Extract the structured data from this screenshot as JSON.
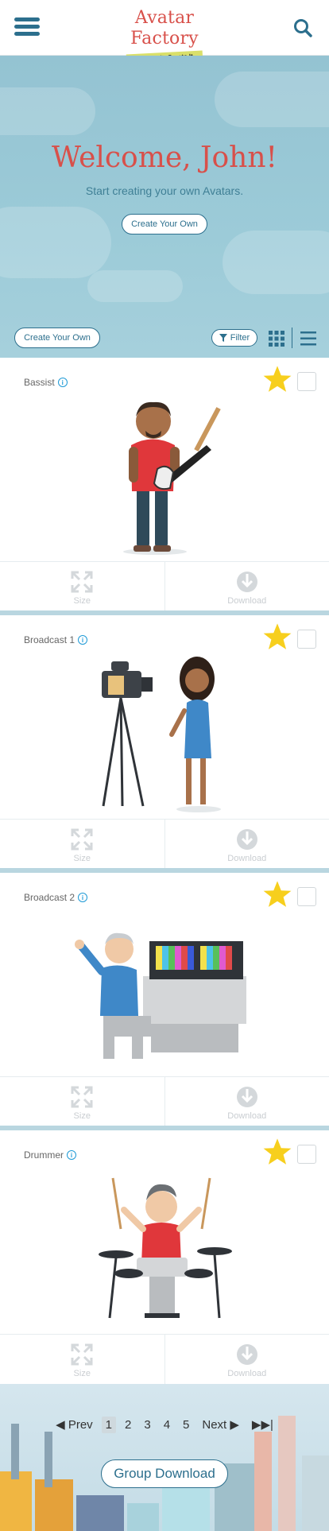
{
  "header": {
    "menu_icon": "hamburger-icon",
    "logo_title": "Avatar Factory",
    "logo_tagline": "Imagine It. Create It.",
    "search_icon": "search-icon"
  },
  "hero": {
    "title": "Welcome, John!",
    "subtitle": "Start creating your own Avatars.",
    "button": "Create Your Own"
  },
  "toolbar": {
    "create_button": "Create Your Own",
    "filter_button": "Filter",
    "grid_icon": "grid-view-icon",
    "list_icon": "list-view-icon"
  },
  "cards": [
    {
      "label": "Bassist",
      "size_label": "Size",
      "download_label": "Download",
      "favorited": true
    },
    {
      "label": "Broadcast 1",
      "size_label": "Size",
      "download_label": "Download",
      "favorited": true
    },
    {
      "label": "Broadcast 2",
      "size_label": "Size",
      "download_label": "Download",
      "favorited": true
    },
    {
      "label": "Drummer",
      "size_label": "Size",
      "download_label": "Download",
      "favorited": true
    }
  ],
  "pagination": {
    "prev": "Prev",
    "pages": [
      "1",
      "2",
      "3",
      "4",
      "5"
    ],
    "current": "1",
    "next": "Next"
  },
  "footer": {
    "group_download": "Group Download"
  },
  "colors": {
    "brand_red": "#d8504a",
    "brand_blue": "#2c6f8d",
    "star_yellow": "#f7cf1d",
    "info_blue": "#1e9ad6"
  }
}
